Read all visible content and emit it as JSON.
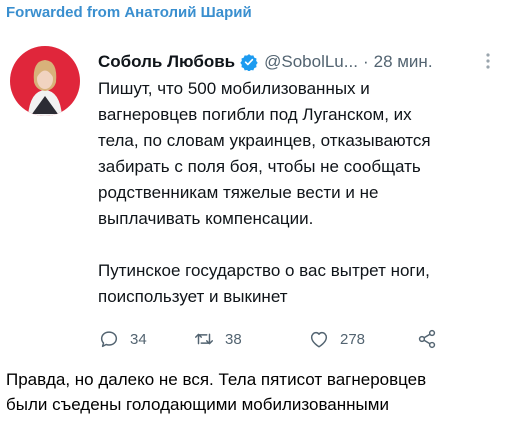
{
  "forward": {
    "label": "Forwarded from Анатолий Шарий"
  },
  "tweet": {
    "author_name": "Соболь Любовь",
    "handle": "@SobolLu...",
    "separator": "·",
    "time": "28 мин.",
    "paragraphs": [
      "Пишут, что 500 мобилизованных и\nвагнеровцев погибли под Луганском, их\nтела, по словам украинцев, отказываются\nзабирать с поля боя, чтобы не сообщать\nродственникам тяжелые вести и не\nвыплачивать компенсации.",
      "Путинское государство о вас вытрет ноги,\nпоиспользует и выкинет"
    ],
    "actions": {
      "reply_count": "34",
      "retweet_count": "38",
      "like_count": "278"
    },
    "icons": {
      "verified": "verified-icon",
      "more": "more-icon",
      "reply": "reply-icon",
      "retweet": "retweet-icon",
      "like": "heart-icon",
      "share": "share-icon"
    },
    "colors": {
      "verified": "#1d9bf0",
      "secondary_text": "#536471",
      "avatar_background": "#e0263b"
    }
  },
  "comment": {
    "text": "Правда, но далеко не вся. Тела пятисот вагнеровцев\nбыли съедены голодающими мобилизованными"
  },
  "header_color": "#3a8fcf"
}
